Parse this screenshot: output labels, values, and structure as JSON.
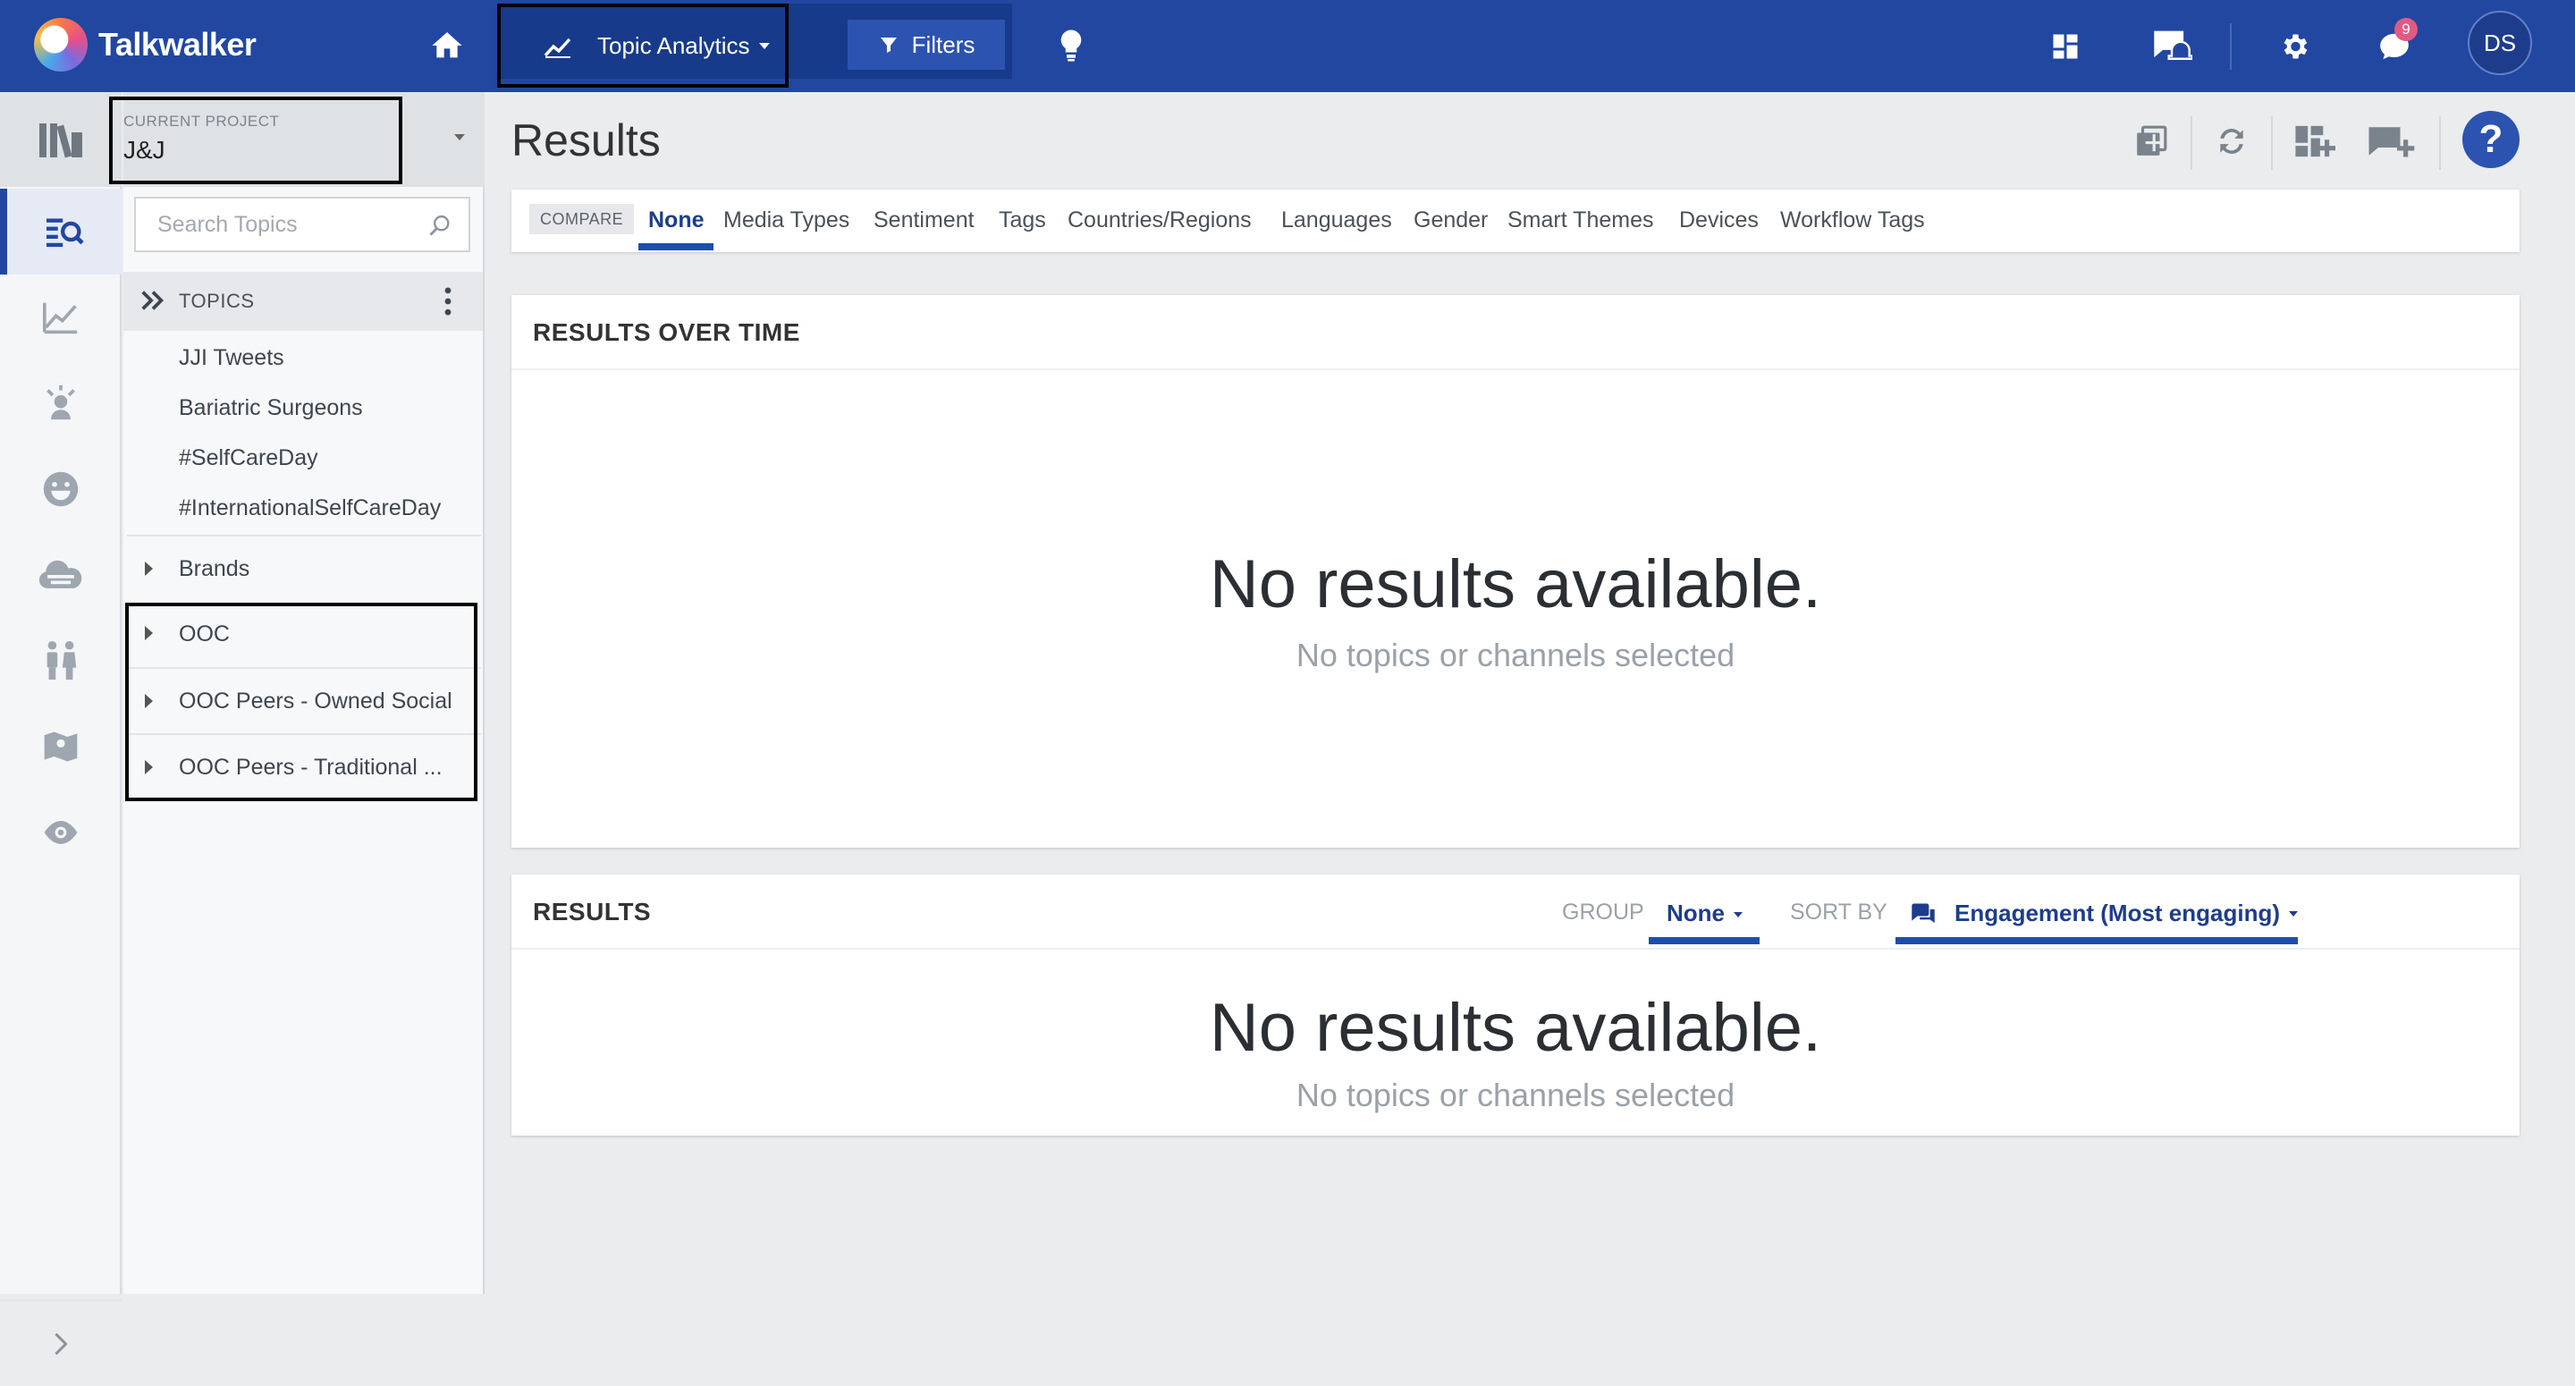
{
  "app": {
    "name": "Talkwalker"
  },
  "topbar": {
    "module_label": "Topic Analytics",
    "filters_label": "Filters",
    "notifications_count": "9",
    "user_initials": "DS"
  },
  "project": {
    "label": "CURRENT PROJECT",
    "name": "J&J"
  },
  "search": {
    "placeholder": "Search Topics"
  },
  "topics": {
    "header": "TOPICS",
    "items": [
      "JJI Tweets",
      "Bariatric Surgeons",
      "#SelfCareDay",
      "#InternationalSelfCareDay"
    ]
  },
  "groups": [
    "Brands",
    "OOC",
    "OOC Peers - Owned Social",
    "OOC Peers - Traditional ..."
  ],
  "main": {
    "title": "Results",
    "compare": {
      "label": "COMPARE",
      "tabs": [
        "None",
        "Media Types",
        "Sentiment",
        "Tags",
        "Countries/Regions",
        "Languages",
        "Gender",
        "Smart Themes",
        "Devices",
        "Workflow Tags"
      ],
      "active": "None"
    },
    "over_time": {
      "title": "RESULTS OVER TIME",
      "empty_title": "No results available.",
      "empty_sub": "No topics or channels selected"
    },
    "results": {
      "title": "RESULTS",
      "group_label": "GROUP",
      "group_value": "None",
      "sort_label": "SORT BY",
      "sort_value": "Engagement (Most engaging)",
      "empty_title": "No results available.",
      "empty_sub": "No topics or channels selected"
    }
  },
  "colors": {
    "primary": "#2147a1",
    "accent": "#1d4eae",
    "badge": "#e05a82"
  }
}
